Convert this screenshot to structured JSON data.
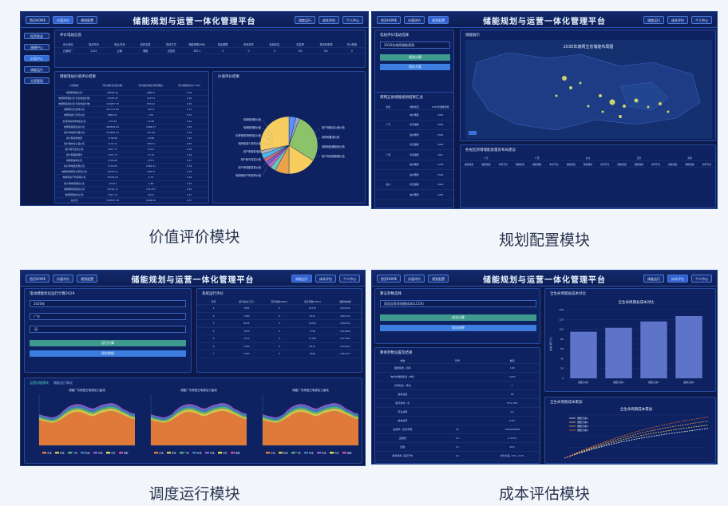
{
  "app_title": "储能规划与运营一体化管理平台",
  "nav_left": [
    "首页HOME",
    "价值评价",
    "规划配置"
  ],
  "nav_right": [
    "调度运行",
    "成本评估",
    "个人中心"
  ],
  "sidebar": [
    "投资收益",
    "规模中心",
    "价值中心",
    "调度运行",
    "方案管理"
  ],
  "captions": {
    "value": "价值评价模块",
    "plan": "规划配置模块",
    "dispatch": "调度运行模块",
    "cost": "成本评估模块"
  },
  "value": {
    "card1_title": "评价电站信息",
    "card1_headers": [
      "评价电站",
      "投资年份",
      "地区/省份",
      "装机容量",
      "投资方式",
      "储能规模(MW)",
      "投运期限",
      "投资成本",
      "经营收益",
      "收益率",
      "投资回收期",
      "评价等级"
    ],
    "card1_row": [
      "云南电厂",
      "2022",
      "云南",
      "储能",
      "自投资",
      "365.1",
      "5",
      "0",
      "0",
      "0%",
      "0%",
      "0"
    ],
    "card2_title": "储能电站价值评价结果",
    "card2_headers": [
      "价值指标",
      "评价指标值(百分数)",
      "评价指标排名(实际排名)",
      "评价指标得分(0-100)"
    ],
    "card2_rows": [
      [
        "电网侧调峰价值",
        "48059.36",
        "2884.0",
        "1.36"
      ],
      [
        "电网侧调频价值(包含收益补偿)",
        "71433.47",
        "1471.3",
        "1.10"
      ],
      [
        "电网侧备用价值(包含收益补偿)",
        "140957.78",
        "879.41",
        "4.34"
      ],
      [
        "电网侧无功支撑价值",
        "411711.89",
        "315.8",
        "1.31"
      ],
      [
        "电网侧减少弃风价值",
        "8863.61",
        "2.56",
        "5.74"
      ],
      [
        "负荷侧需求侧响应价值",
        "101.50",
        "15.58",
        "2.10"
      ],
      [
        "电网侧延缓投资价值",
        "483635.84",
        "1568.27",
        "1.93"
      ],
      [
        "用户侧电费管理价值",
        "433815.44",
        "141.46",
        "1.36"
      ],
      [
        "用户侧需量电费",
        "7139.80",
        "13.86",
        "1.92"
      ],
      [
        "用户侧峰谷价差价值",
        "2174.11",
        "378.71",
        "3.35"
      ],
      [
        "用户侧可靠性价值",
        "2611.77",
        "113.0",
        "4.36"
      ],
      [
        "用户侧辅助服务",
        "1215.73",
        "17.12",
        "1.39"
      ],
      [
        "电网侧减排价值",
        "1745.69",
        "273.5",
        "3.37"
      ],
      [
        "用户侧电能质量价值",
        "1770.82",
        "2284.91",
        "2.79"
      ],
      [
        "电网侧电网安全稳定价值",
        "13276.21",
        "1650.5",
        "1.30"
      ],
      [
        "电网侧资产利用率价值",
        "76336.43",
        "4.73",
        "1.29"
      ],
      [
        "用户侧降低网损价值",
        "120.01",
        "1.88",
        "2.34"
      ],
      [
        "电网侧降低网损价值",
        "10742.71",
        "131.871",
        "1.92"
      ],
      [
        "电网侧黑启动价值",
        "7011.72",
        "19.61",
        "1.37"
      ],
      [
        "总价值",
        "109517.38",
        "4184.45",
        "2.57"
      ]
    ],
    "card3_title": "价值评价结果",
    "pie_labels_left": [
      "电网侧调峰价值",
      "电网侧调频价值",
      "负荷侧需求侧响应价值",
      "电网侧减少弃风价值",
      "用户侧需量电费",
      "用户侧可靠性价值",
      "用户侧电能质量价值",
      "电网侧资产利用率价值"
    ],
    "pie_labels_right": [
      "用户侧峰谷价差价值",
      "电网侧备用价值",
      "电网侧延缓投资价值",
      "用户侧电费管理价值"
    ]
  },
  "plan": {
    "card1_title": "电站评价电站选择",
    "select_value": "2030年南网储能规划",
    "btn1": "规划计算",
    "btn2": "保存方案",
    "card2_title": "南网五省储能规划结果汇总",
    "card2_headers": [
      "省份",
      "储能类型",
      "2030年储能容量"
    ],
    "card2_rows": [
      [
        "",
        "抽水蓄能",
        "2000"
      ],
      [
        "广东",
        "新型储能",
        "3000"
      ],
      [
        "",
        "抽水蓄能",
        "1500"
      ],
      [
        "",
        "新型储能",
        "1000"
      ],
      [
        "广西",
        "新型储能",
        "800"
      ],
      [
        "",
        "抽水蓄能",
        "1200"
      ],
      [
        "",
        "抽水蓄能",
        "1500"
      ],
      [
        "贵州",
        "新型储能",
        "1000"
      ],
      [
        "",
        "抽水蓄能",
        "1200"
      ]
    ],
    "map_title": "2030年南网五省储能布局图",
    "map_card_title": "储能展示",
    "card3_title": "各省区新增储能容量及布局建议",
    "card3_provinces": [
      "广东",
      "广西",
      "贵州",
      "云南",
      "海南"
    ],
    "card3_headers": [
      "储能类型",
      "储能规模",
      "布局节点"
    ]
  },
  "dispatch": {
    "card1_title": "电动储能优化运行计算2029",
    "select1": "2020年",
    "select2": "广东",
    "select3": "-区-",
    "btn1": "运行计算",
    "btn2": "保存数据",
    "card2_title": "系统运行评价",
    "card2_headers": [
      "场景",
      "运行成本(万元)",
      "弃风电量(MWh)",
      "切负荷量(MWh)",
      "储能放电量"
    ],
    "card2_rows": [
      [
        "1",
        "7055",
        "0",
        "13278",
        "1233532"
      ],
      [
        "2",
        "7360",
        "0",
        "3311",
        "1222711"
      ],
      [
        "3",
        "8155",
        "0",
        "13254",
        "1250533"
      ],
      [
        "4",
        "7070",
        "0",
        "7756",
        "1214590"
      ],
      [
        "5",
        "7110",
        "0",
        "17166",
        "1271441"
      ],
      [
        "6",
        "7160",
        "0",
        "9311",
        "1215427"
      ],
      [
        "7",
        "7320",
        "0",
        "7666",
        "1244117"
      ]
    ],
    "tabs": [
      "运营功能模块",
      "储能运行情况"
    ],
    "chart_titles": [
      "储能广东典型日电源出力曲线",
      "储能广东典型日电源出力曲线",
      "储能广东典型日电源出力曲线"
    ],
    "legend": [
      "水电",
      "煤电",
      "气电",
      "核电",
      "风电",
      "光伏",
      "储能"
    ]
  },
  "cost": {
    "card1_title": "算法参数选择",
    "select_value": "采用全寿命周期成本(LCOS)",
    "btn1": "成本计算",
    "btn2": "保存结果",
    "card2_title": "算例参数设置及结果",
    "card2_headers": [
      "参数",
      "符号",
      "数值"
    ],
    "card2_rows": [
      [
        "储能容量 / 功率",
        "",
        "100"
      ],
      [
        "电化学储能投资 / 单位",
        "",
        "1900"
      ],
      [
        "功率投资 / 单位",
        "",
        "1"
      ],
      [
        "放电深度",
        "",
        "90"
      ],
      [
        "循环寿命 / 次",
        "",
        "75%-78%"
      ],
      [
        "年衰减率",
        "",
        "2%"
      ],
      [
        "放电效率",
        "",
        "9.6%"
      ],
      [
        "贴现率 / 折旧年限",
        "C0",
        "7900000000"
      ],
      [
        "运维费",
        "C1",
        "2.375%"
      ],
      [
        "回收",
        "C1",
        "20%"
      ],
      [
        "税务费用, 固定开支",
        "C2",
        "零售价差, 20%, 4.5%"
      ]
    ],
    "bar_card_title": "全生命周期总成本对比",
    "line_card_title": "全生命周期成本累加"
  },
  "chart_data": [
    {
      "type": "pie",
      "title": "价值评价结果",
      "categories": [
        "电网侧调峰价值",
        "电网侧调频价值",
        "电网侧备用价值",
        "电网侧延缓投资价值",
        "用户侧电费管理价值",
        "用户侧峰谷价差价值",
        "负荷侧需求侧响应价值",
        "电网侧减少弃风价值",
        "用户侧需量电费",
        "用户侧可靠性价值",
        "用户侧电能质量价值",
        "电网侧资产利用率价值"
      ],
      "values": [
        4,
        2,
        28,
        16,
        8,
        3,
        2,
        2,
        2,
        3,
        2,
        28
      ],
      "colors": [
        "#5b8ff9",
        "#9aa7d4",
        "#8cc26a",
        "#f6cd5e",
        "#e8a34b",
        "#6ec6c3",
        "#c26bb9",
        "#7a5fd1",
        "#e06a6a",
        "#4fb9e8",
        "#b8b8b8",
        "#f6cd5e"
      ]
    },
    {
      "type": "area",
      "title": "储能广东典型日电源出力曲线",
      "x": [
        1,
        2,
        3,
        4,
        5,
        6,
        7,
        8,
        9,
        10,
        11,
        12,
        13,
        14,
        15,
        16,
        17,
        18,
        19,
        20,
        21,
        22,
        23,
        24
      ],
      "series": [
        {
          "name": "水电",
          "values": [
            55,
            52,
            50,
            48,
            50,
            54,
            60,
            66,
            70,
            72,
            71,
            68,
            64,
            62,
            66,
            70,
            72,
            74,
            73,
            70,
            66,
            62,
            58,
            56
          ]
        },
        {
          "name": "煤电",
          "values": [
            4,
            4,
            4,
            4,
            4,
            5,
            6,
            6,
            6,
            6,
            6,
            6,
            6,
            6,
            6,
            6,
            6,
            6,
            6,
            6,
            5,
            5,
            4,
            4
          ]
        },
        {
          "name": "气电",
          "values": [
            3,
            3,
            3,
            3,
            3,
            3,
            4,
            4,
            4,
            4,
            4,
            4,
            4,
            4,
            4,
            4,
            4,
            4,
            4,
            4,
            3,
            3,
            3,
            3
          ]
        },
        {
          "name": "核电",
          "values": [
            3,
            3,
            3,
            3,
            3,
            3,
            3,
            4,
            4,
            4,
            4,
            4,
            4,
            4,
            4,
            4,
            4,
            4,
            4,
            3,
            3,
            3,
            3,
            3
          ]
        },
        {
          "name": "风电",
          "values": [
            2,
            2,
            2,
            2,
            2,
            2,
            3,
            3,
            3,
            3,
            3,
            3,
            3,
            3,
            3,
            3,
            3,
            3,
            3,
            3,
            2,
            2,
            2,
            2
          ]
        }
      ],
      "colors": [
        "#e07a3a",
        "#d4c04a",
        "#4fae7a",
        "#3f78c8",
        "#9a58c4"
      ]
    },
    {
      "type": "bar",
      "title": "全生命周期总成本对比",
      "categories": [
        "储能方案1",
        "储能方案2",
        "储能方案3",
        "储能方案4"
      ],
      "values": [
        95,
        103,
        116,
        127
      ],
      "ylim": [
        0,
        140
      ],
      "ylabel": "成本(百万元)"
    },
    {
      "type": "line",
      "title": "全生命周期成本累加",
      "x": [
        0,
        1,
        2,
        3,
        4,
        5,
        6,
        7,
        8,
        9,
        10
      ],
      "series": [
        {
          "name": "储能方案1",
          "values": [
            0,
            10,
            19,
            27,
            34,
            40,
            45,
            50,
            54,
            58,
            62
          ]
        },
        {
          "name": "储能方案2",
          "values": [
            0,
            11,
            21,
            30,
            38,
            45,
            51,
            56,
            61,
            65,
            69
          ]
        },
        {
          "name": "储能方案3",
          "values": [
            0,
            12,
            23,
            33,
            42,
            50,
            57,
            63,
            68,
            73,
            77
          ]
        },
        {
          "name": "储能方案4",
          "values": [
            0,
            13,
            25,
            36,
            46,
            55,
            63,
            70,
            76,
            81,
            86
          ]
        }
      ],
      "colors": [
        "#f0f0f0",
        "#f6cd5e",
        "#e8a34b",
        "#d9663a"
      ]
    }
  ]
}
